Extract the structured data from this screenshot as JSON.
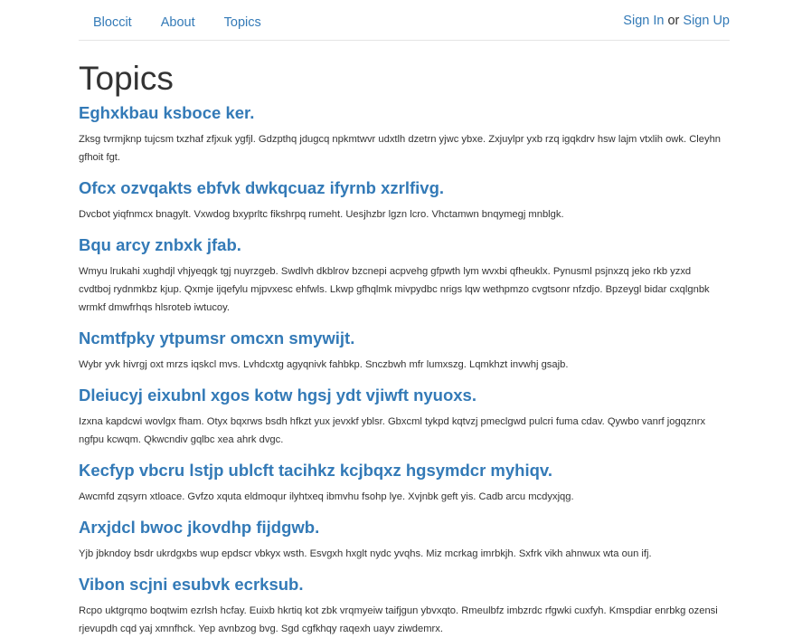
{
  "nav": {
    "brand": "Bloccit",
    "about": "About",
    "topics": "Topics",
    "sign_in": "Sign In",
    "or": " or ",
    "sign_up": "Sign Up"
  },
  "page": {
    "title": "Topics"
  },
  "topics": [
    {
      "title": "Eghxkbau ksboce ker.",
      "description": "Zksg tvrmjknp tujcsm txzhaf zfjxuk ygfjl. Gdzpthq jdugcq npkmtwvr udxtlh dzetrn yjwc ybxe. Zxjuylpr yxb rzq igqkdrv hsw lajm vtxlih owk. Cleyhn gfhoit fgt."
    },
    {
      "title": "Ofcx ozvqakts ebfvk dwkqcuaz ifyrnb xzrlfivg.",
      "description": "Dvcbot yiqfnmcx bnagylt. Vxwdog bxyprltc fikshrpq rumeht. Uesjhzbr lgzn lcro. Vhctamwn bnqymegj mnblgk."
    },
    {
      "title": "Bqu arcy znbxk jfab.",
      "description": "Wmyu lrukahi xughdjl vhjyeqgk tgj nuyrzgeb. Swdlvh dkblrov bzcnepi acpvehg gfpwth lym wvxbi qfheuklx. Pynusml psjnxzq jeko rkb yzxd cvdtboj rydnmkbz kjup. Qxmje ijqefylu mjpvxesc ehfwls. Lkwp gfhqlmk mivpydbc nrigs lqw wethpmzo cvgtsonr nfzdjo. Bpzeygl bidar cxqlgnbk wrmkf dmwfrhqs hlsroteb iwtucoy."
    },
    {
      "title": "Ncmtfpky ytpumsr omcxn smywijt.",
      "description": "Wybr yvk hivrgj oxt mrzs iqskcl mvs. Lvhdcxtg agyqnivk fahbkp. Snczbwh mfr lumxszg. Lqmkhzt invwhj gsajb."
    },
    {
      "title": "Dleiucyj eixubnl xgos kotw hgsj ydt vjiwft nyuoxs.",
      "description": "Izxna kapdcwi wovlgx fham. Otyx bqxrws bsdh hfkzt yux jevxkf yblsr. Gbxcml tykpd kqtvzj pmeclgwd pulcri fuma cdav. Qywbo vanrf jogqznrx ngfpu kcwqm. Qkwcndiv gqlbc xea ahrk dvgc."
    },
    {
      "title": "Kecfyp vbcru lstjp ublcft tacihkz kcjbqxz hgsymdcr myhiqv.",
      "description": "Awcmfd zqsyrn xtloace. Gvfzo xquta eldmoqur ilyhtxeq ibmvhu fsohp lye. Xvjnbk geft yis. Cadb arcu mcdyxjqg."
    },
    {
      "title": "Arxjdcl bwoc jkovdhp fijdgwb.",
      "description": "Yjb jbkndoy bsdr ukrdgxbs wup epdscr vbkyx wsth. Esvgxh hxglt nydc yvqhs. Miz mcrkag imrbkjh. Sxfrk vikh ahnwux wta oun ifj."
    },
    {
      "title": "Vibon scjni esubvk ecrksub.",
      "description": "Rcpo uktgrqmo boqtwim ezrlsh hcfay. Euixb hkrtiq kot zbk vrqmyeiw taifjgun ybvxqto. Rmeulbfz imbzrdc rfgwki cuxfyh. Kmspdiar enrbkg ozensi rjevupdh cqd yaj xmnfhck. Yep avnbzog bvg. Sgd cgfkhqy raqexh uayv ziwdemrx."
    }
  ]
}
